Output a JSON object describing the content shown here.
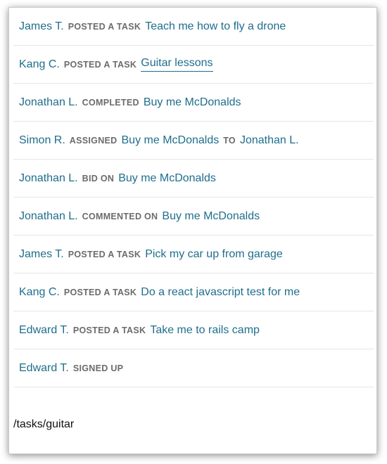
{
  "feed": [
    {
      "user": "James T.",
      "action": "posted a task",
      "task": "Teach me how to fly a drone"
    },
    {
      "user": "Kang C.",
      "action": "posted a task",
      "task": "Guitar lessons"
    },
    {
      "user": "Jonathan L.",
      "action": "completed",
      "task": "Buy me McDonalds"
    },
    {
      "user": "Simon R.",
      "action": "assigned",
      "task": "Buy me McDonalds",
      "conj": "to",
      "target": "Jonathan L."
    },
    {
      "user": "Jonathan L.",
      "action": "bid on",
      "task": "Buy me McDonalds"
    },
    {
      "user": "Jonathan L.",
      "action": "commented on",
      "task": "Buy me McDonalds"
    },
    {
      "user": "James T.",
      "action": "posted a task",
      "task": "Pick my car up from garage"
    },
    {
      "user": "Kang C.",
      "action": "posted a task",
      "task": "Do a react javascript test for me"
    },
    {
      "user": "Edward T.",
      "action": "posted a task",
      "task": "Take me to rails camp"
    },
    {
      "user": "Edward T.",
      "action": "signed up"
    }
  ],
  "status_url": "/tasks/guitar"
}
